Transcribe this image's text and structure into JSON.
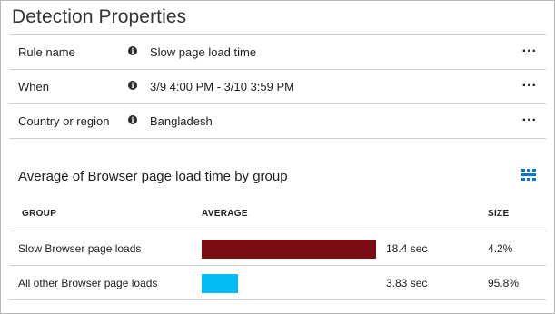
{
  "panel": {
    "title": "Detection Properties"
  },
  "properties": [
    {
      "label": "Rule name",
      "value": "Slow page load time",
      "info_icon": "info-icon",
      "menu_icon": "more-icon",
      "more_glyph": "..."
    },
    {
      "label": "When",
      "value": "3/9 4:00 PM - 3/10 3:59 PM",
      "info_icon": "info-icon",
      "menu_icon": "more-icon",
      "more_glyph": "..."
    },
    {
      "label": "Country or region",
      "value": "Bangladesh",
      "info_icon": "info-icon",
      "menu_icon": "more-icon",
      "more_glyph": "..."
    }
  ],
  "group_table": {
    "title": "Average of Browser page load time by group",
    "view_icon": "grid-view-icon",
    "columns": {
      "group": "GROUP",
      "average": "AVERAGE",
      "size": "SIZE"
    },
    "rows": [
      {
        "group": "Slow Browser page loads",
        "average": "18.4 sec",
        "size": "4.2%",
        "bar_color": "#7a0c14",
        "average_value": 18.4
      },
      {
        "group": "All other Browser page loads",
        "average": "3.83 sec",
        "size": "95.8%",
        "bar_color": "#00bcf2",
        "average_value": 3.83
      }
    ]
  },
  "colors": {
    "accent": "#0078d4",
    "slow_bar": "#7a0c14",
    "other_bar": "#00bcf2"
  }
}
